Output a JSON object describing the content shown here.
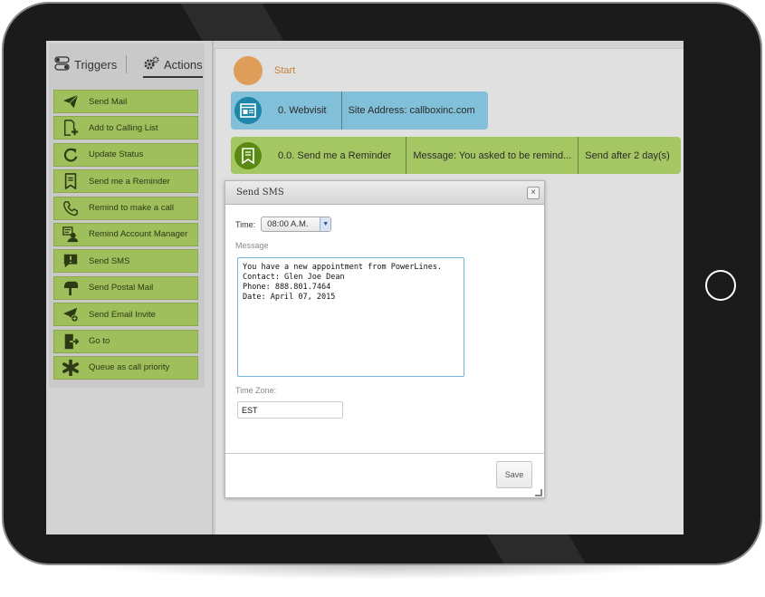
{
  "sidebar": {
    "tabs": {
      "triggers_label": "Triggers",
      "actions_label": "Actions"
    },
    "actions": [
      {
        "label": "Send Mail",
        "icon": "paper-plane-icon"
      },
      {
        "label": "Add to Calling List",
        "icon": "add-to-list-icon"
      },
      {
        "label": "Update Status",
        "icon": "refresh-icon"
      },
      {
        "label": "Send me a Reminder",
        "icon": "reminder-icon"
      },
      {
        "label": "Remind to make a call",
        "icon": "phone-icon"
      },
      {
        "label": "Remind Account Manager",
        "icon": "account-manager-icon"
      },
      {
        "label": "Send SMS",
        "icon": "sms-icon"
      },
      {
        "label": "Send Postal Mail",
        "icon": "mailbox-icon"
      },
      {
        "label": "Send Email Invite",
        "icon": "email-invite-icon"
      },
      {
        "label": "Go to",
        "icon": "go-to-icon"
      },
      {
        "label": "Queue as call priority",
        "icon": "asterisk-icon"
      }
    ]
  },
  "workflow": {
    "start_label": "Start",
    "webvisit": {
      "name": "0. Webvisit",
      "detail": "Site Address: callboxinc.com"
    },
    "reminder": {
      "name": "0.0. Send me a Reminder",
      "message": "Message: You asked to be remind...",
      "schedule": "Send after 2 day(s)"
    }
  },
  "dialog": {
    "title": "Send SMS",
    "time_label": "Time:",
    "time_value": "08:00 A.M.",
    "message_label": "Message",
    "message_text": "You have a new appointment from PowerLines.\nContact: Glen Joe Dean\nPhone: 888.801.7464\nDate: April 07, 2015",
    "timezone_label": "Time Zone:",
    "timezone_value": "EST",
    "save_label": "Save"
  },
  "colors": {
    "action_green": "#9fbf5c",
    "node_blue": "#82bfd9",
    "node_green": "#a5c763",
    "start_orange": "#de9e5a"
  }
}
